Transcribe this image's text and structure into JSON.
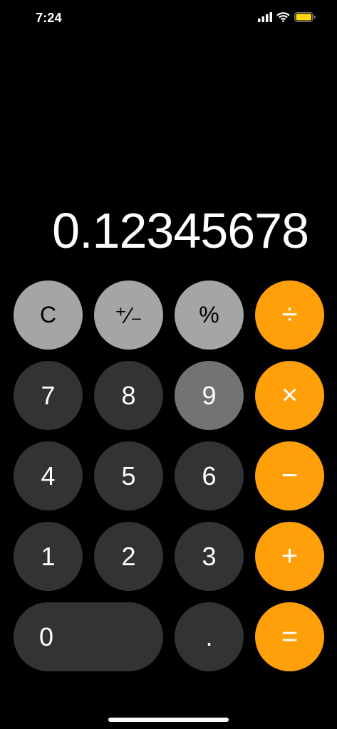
{
  "status_bar": {
    "time": "7:24",
    "icons": [
      "signal-icon",
      "wifi-icon",
      "battery-icon"
    ],
    "battery_color": "#ffd60a"
  },
  "display": {
    "value": "0.12345678"
  },
  "keypad": {
    "clear": "C",
    "plus_minus": "⁺∕₋",
    "percent": "%",
    "divide": "÷",
    "seven": "7",
    "eight": "8",
    "nine": "9",
    "multiply": "×",
    "four": "4",
    "five": "5",
    "six": "6",
    "minus": "−",
    "one": "1",
    "two": "2",
    "three": "3",
    "plus": "+",
    "zero": "0",
    "decimal": ".",
    "equals": "="
  },
  "colors": {
    "background": "#000000",
    "function_key": "#a5a5a5",
    "number_key": "#333333",
    "number_key_pressed": "#737373",
    "operator_key": "#ff9f0a"
  }
}
